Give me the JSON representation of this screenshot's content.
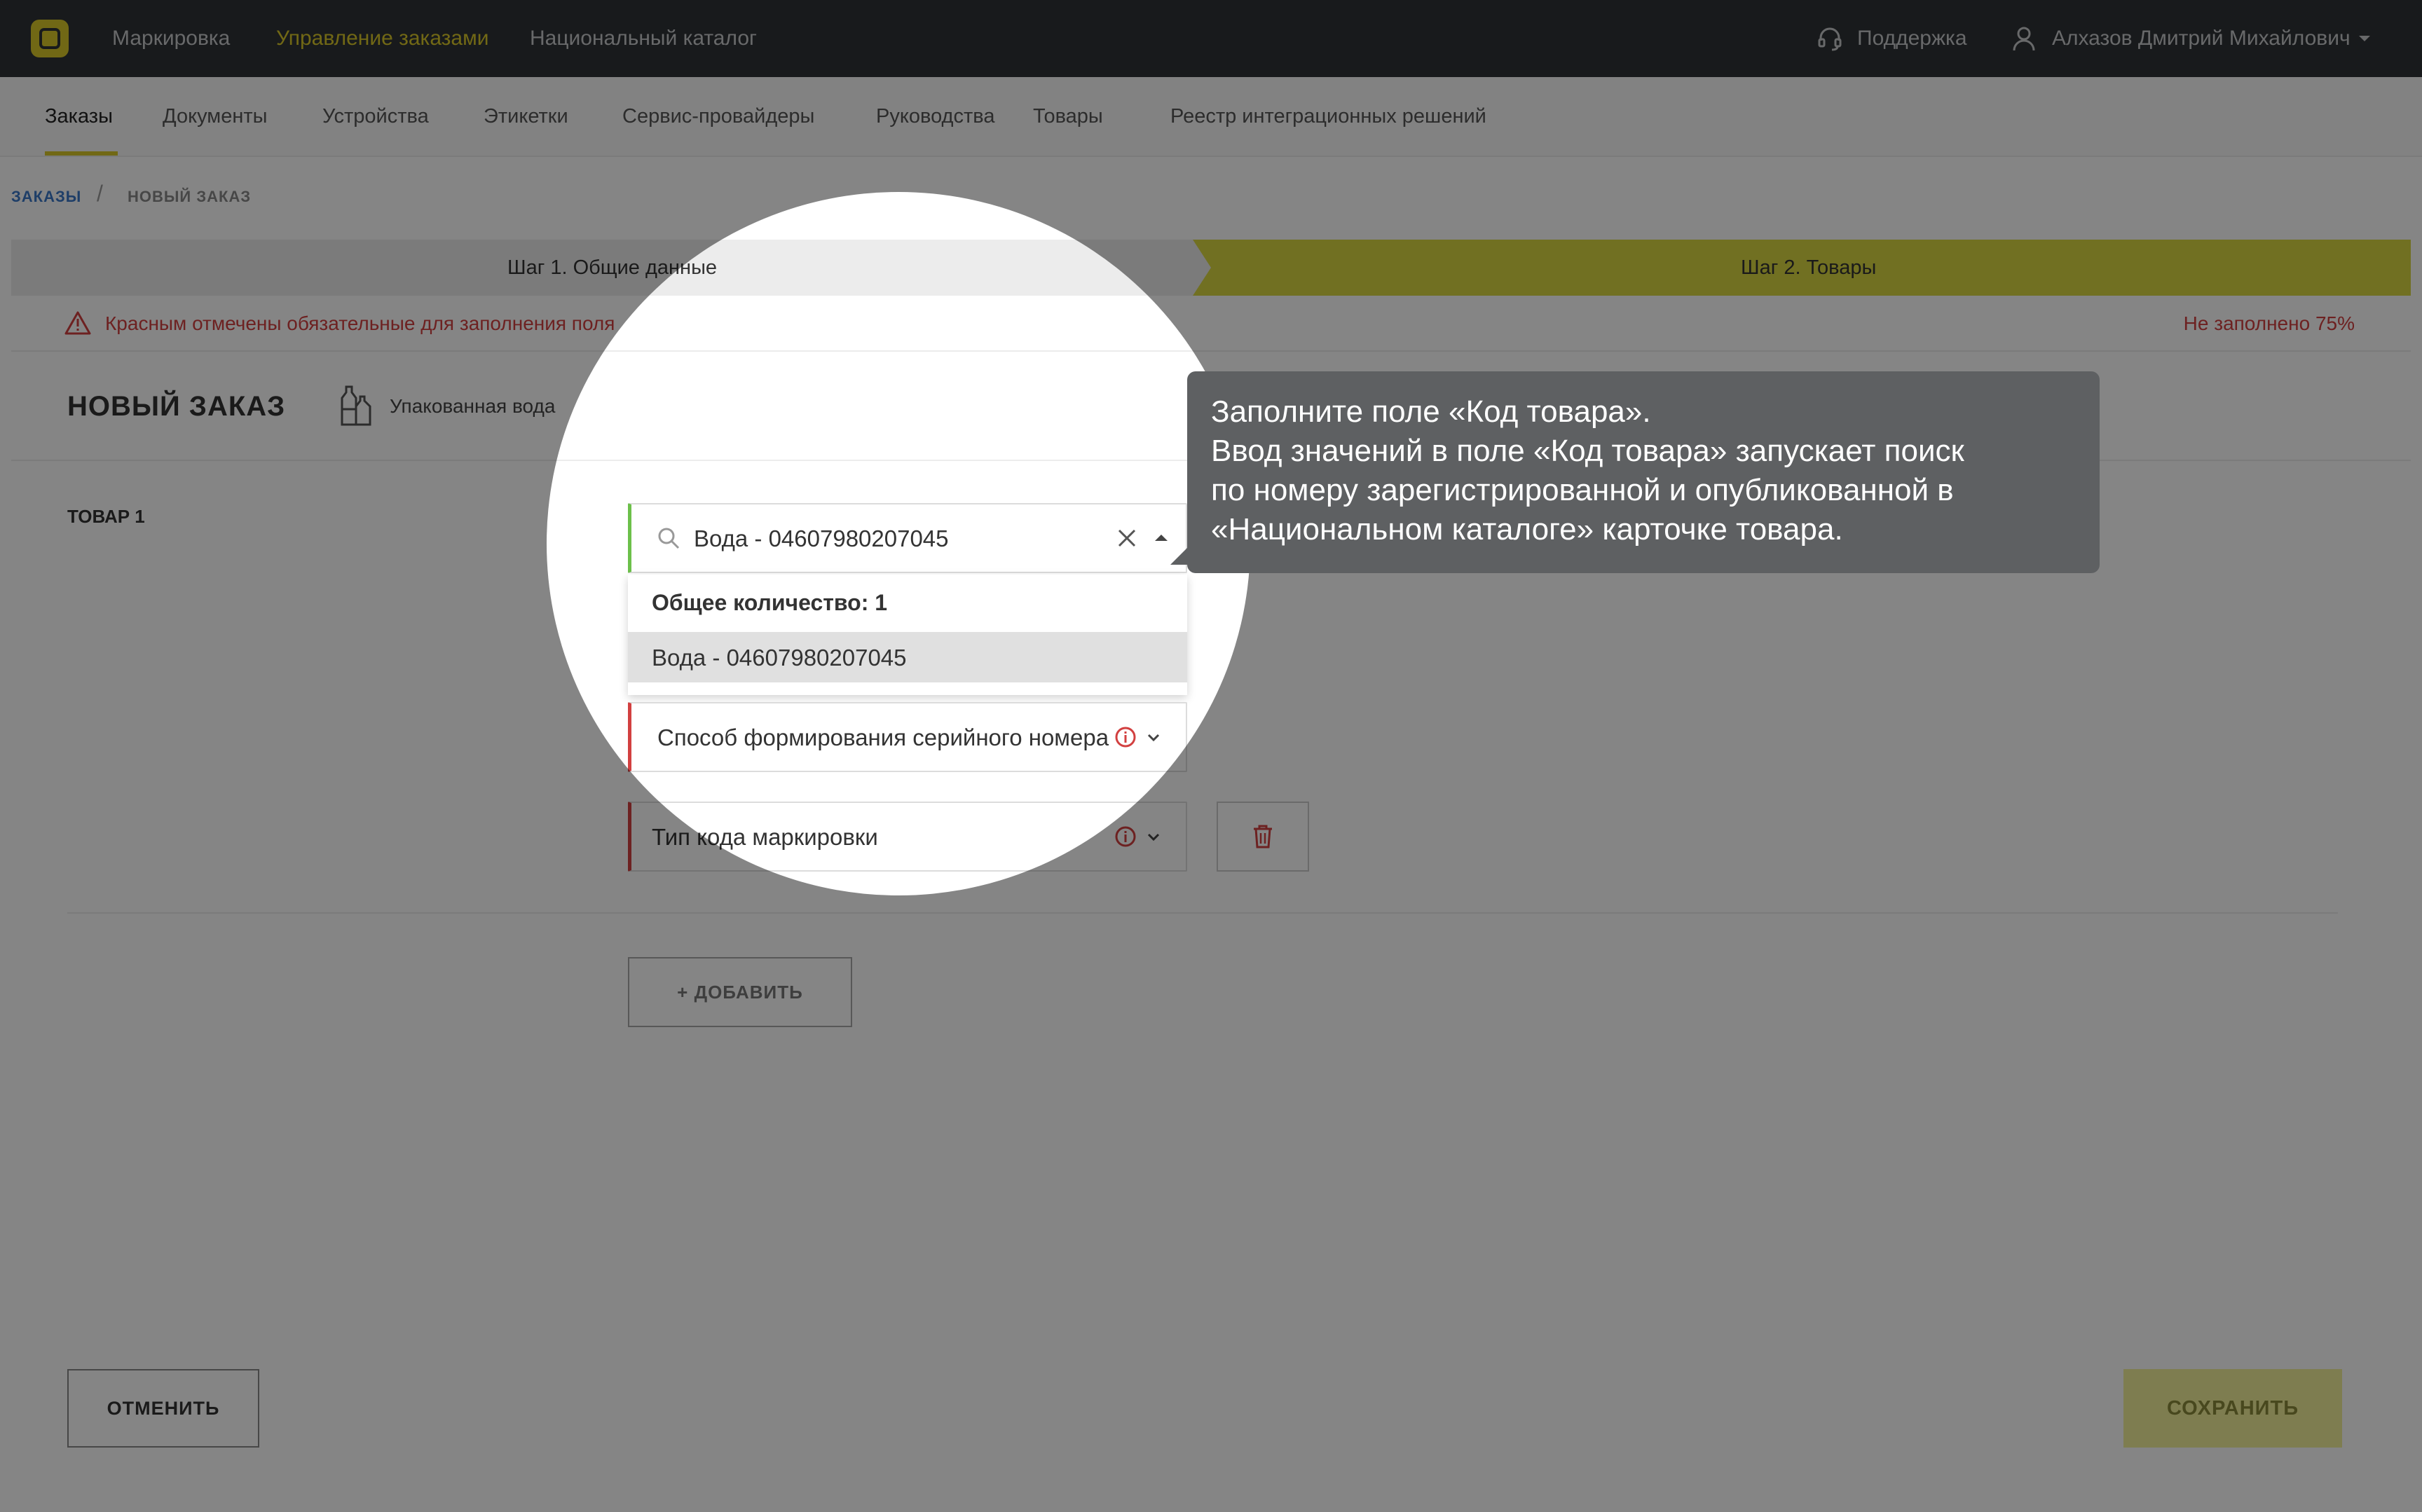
{
  "topbar": {
    "nav": [
      {
        "label": "Маркировка"
      },
      {
        "label": "Управление заказами"
      },
      {
        "label": "Национальный каталог"
      }
    ],
    "support": "Поддержка",
    "user": "Алхазов Дмитрий Михайлович",
    "accent": "#d8c72a"
  },
  "subnav": {
    "tabs": [
      {
        "label": "Заказы"
      },
      {
        "label": "Документы"
      },
      {
        "label": "Устройства"
      },
      {
        "label": "Этикетки"
      },
      {
        "label": "Сервис-провайдеры"
      },
      {
        "label": "Руководства"
      },
      {
        "label": "Товары"
      },
      {
        "label": "Реестр интеграционных решений"
      }
    ]
  },
  "breadcrumb": {
    "root": "ЗАКАЗЫ",
    "separator": "/",
    "current": "НОВЫЙ ЗАКАЗ"
  },
  "steps": [
    {
      "label": "Шаг 1. Общие данные"
    },
    {
      "label": "Шаг 2. Товары"
    }
  ],
  "warning": {
    "text": "Красным отмечены обязательные для заполнения поля",
    "progress": "Не заполнено 75%"
  },
  "order": {
    "title": "НОВЫЙ ЗАКАЗ",
    "category": "Упакованная вода"
  },
  "item": {
    "label": "ТОВАР 1",
    "product_code_value": "Вода - 04607980207045",
    "dropdown": {
      "header": "Общее количество: 1",
      "options": [
        "Вода - 04607980207045"
      ]
    },
    "serial_method_placeholder": "Способ формирования серийного номера",
    "code_type_placeholder": "Тип кода маркировки"
  },
  "buttons": {
    "add": "+ ДОБАВИТЬ",
    "cancel": "ОТМЕНИТЬ",
    "save": "СОХРАНИТЬ"
  },
  "tooltip": {
    "lines": [
      "Заполните поле «Код товара».",
      "Ввод значений в поле «Код товара» запускает поиск",
      "по номеру зарегистрированной и опубликованной в",
      "«Национальном каталоге» карточке товара."
    ]
  }
}
